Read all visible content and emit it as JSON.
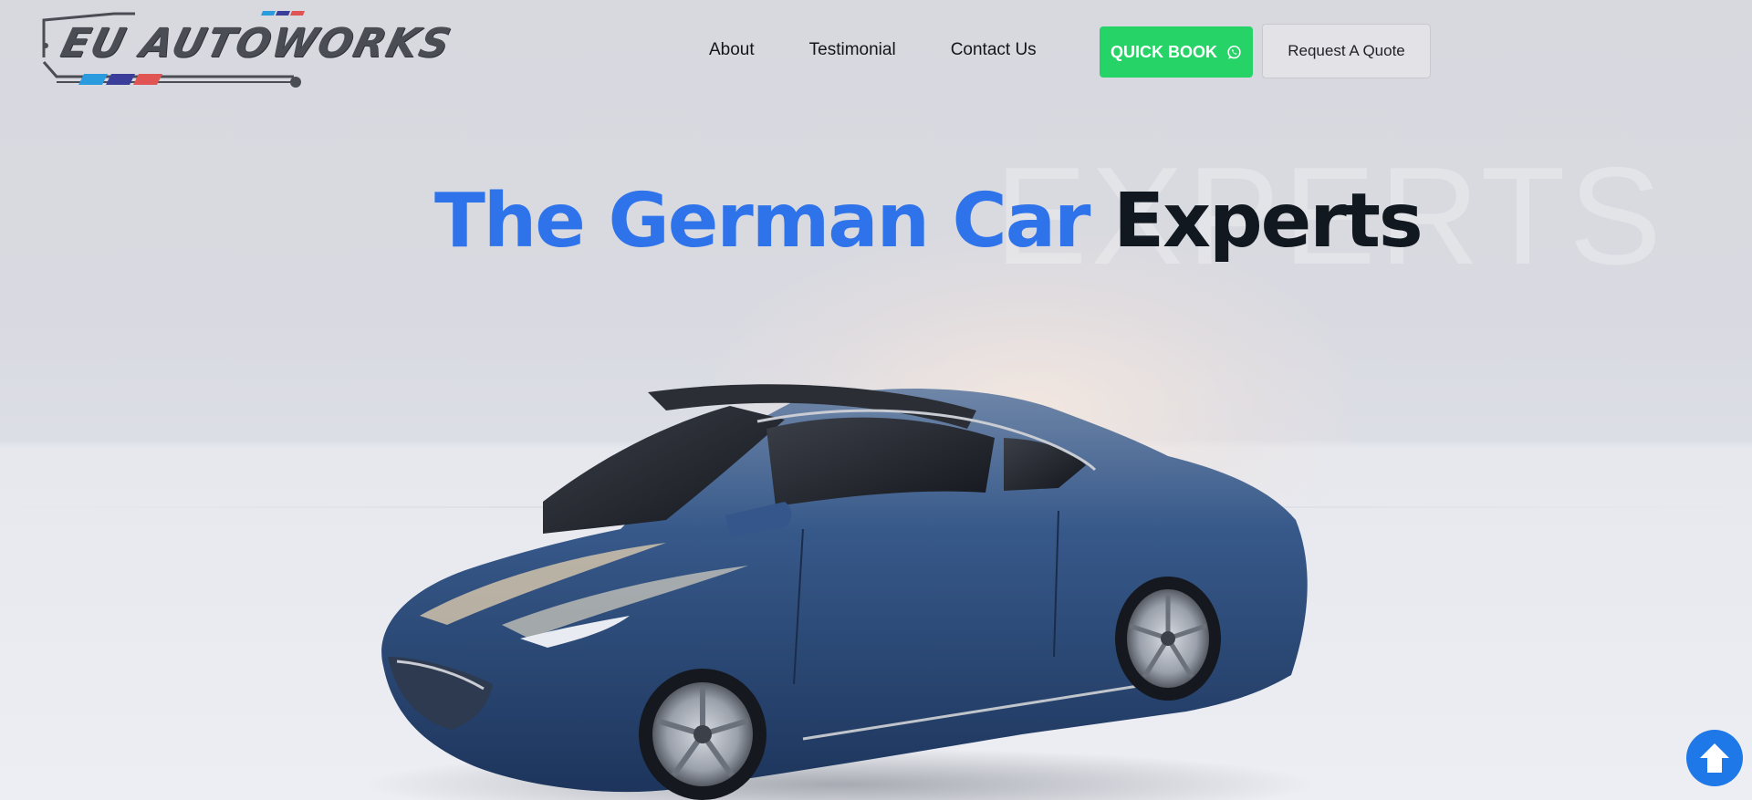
{
  "header": {
    "logo_text": "EU AUTOWORKS",
    "nav": [
      {
        "label": "About"
      },
      {
        "label": "Testimonial"
      },
      {
        "label": "Contact Us"
      }
    ],
    "quick_book_label": "QUICK BOOK",
    "quick_book_icon": "whatsapp-icon",
    "quote_label": "Request A Quote"
  },
  "hero": {
    "headline_blue": "The German Car",
    "headline_dark": "Experts",
    "background_word": "EXPERTS"
  },
  "colors": {
    "brand_blue": "#2f73ea",
    "whatsapp_green": "#25d366",
    "headline_dark": "#111820",
    "car_blue": "#2e4f80"
  },
  "icons": {
    "scroll_top": "arrow-up-icon"
  }
}
